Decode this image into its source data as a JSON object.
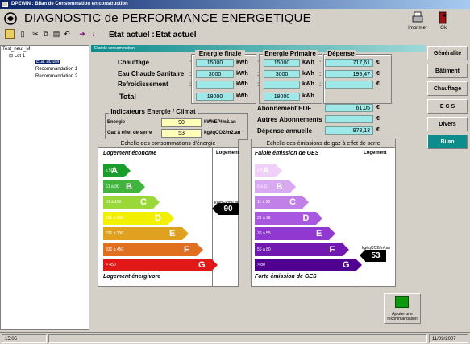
{
  "window_title": "DPEWIN : Bilan de Consommation en construction",
  "app_title": "DIAGNOSTIC de PERFORMANCE ENERGETIQUE",
  "etat_label": "Etat actuel :",
  "etat_value": "Etat actuel",
  "toolbar": {
    "print_label": "Imprimer",
    "ok_label": "Ok"
  },
  "tree": {
    "root": "Test_neuf_MI",
    "lot": "Lot 1",
    "items": [
      "Etat actuel",
      "Recommandation 1",
      "Recommandation 2"
    ]
  },
  "panel_title": "Etat de consommation",
  "columns": {
    "energie_finale": "Energie finale",
    "energie_primaire": "Energie Primaire",
    "depense": "Dépense"
  },
  "rows": [
    {
      "label": "Chauffage",
      "ef": "15000",
      "ef_unit": "kWh",
      "ep": "15000",
      "ep_unit": "kWh",
      "dep": "717,61",
      "dep_unit": "€"
    },
    {
      "label": "Eau Chaude Sanitaire",
      "ef": "3000",
      "ef_unit": "kWh",
      "ep": "3000",
      "ep_unit": "kWh",
      "dep": "199,47",
      "dep_unit": "€"
    },
    {
      "label": "Refroidissement",
      "ef": "",
      "ef_unit": "kWh",
      "ep": "",
      "ep_unit": "kWh",
      "dep": "",
      "dep_unit": "€"
    }
  ],
  "total": {
    "label": "Total",
    "ef": "18000",
    "ef_unit": "kWh",
    "ep": "18000",
    "ep_unit": "kWh"
  },
  "indicateurs": {
    "title": "Indicateurs Energie / Climat",
    "energie_label": "Energie",
    "energie_value": "90",
    "energie_unit": "kWhEP/m2.an",
    "ges_label": "Gaz à effet de serre",
    "ges_value": "53",
    "ges_unit": "kgéqCO2/m2.an"
  },
  "abonnements": [
    {
      "label": "Abonnement EDF",
      "value": "61,05",
      "unit": "€"
    },
    {
      "label": "Autres Abonnements",
      "value": "",
      "unit": "€"
    },
    {
      "label": "Dépense annuelle",
      "value": "978,13",
      "unit": "€"
    }
  ],
  "energy_label": {
    "title": "Echelle des consommations d'énergie",
    "top": "Logement économe",
    "bottom": "Logement énergivore",
    "col": "Logement",
    "value": "90",
    "unit": "kWhEP/m².an",
    "classes": [
      {
        "range": "≤ 50",
        "letter": "A",
        "color": "#1a9c2a"
      },
      {
        "range": "51 à 90",
        "letter": "B",
        "color": "#40b43c"
      },
      {
        "range": "91 à 150",
        "letter": "C",
        "color": "#9ad83a"
      },
      {
        "range": "151 à 230",
        "letter": "D",
        "color": "#f2f000"
      },
      {
        "range": "231 à 330",
        "letter": "E",
        "color": "#e0a020"
      },
      {
        "range": "331 à 450",
        "letter": "F",
        "color": "#e07020"
      },
      {
        "range": "> 450",
        "letter": "G",
        "color": "#e01818"
      }
    ]
  },
  "ges_label": {
    "title": "Echelle des émissions de gaz à effet de serre",
    "top": "Faible émission de GES",
    "bottom": "Forte émission de GES",
    "col": "Logement",
    "value": "53",
    "unit": "kgéqCO2/m².an",
    "classes": [
      {
        "range": "≤ 5",
        "letter": "A",
        "color": "#f0d0f8"
      },
      {
        "range": "6 à 10",
        "letter": "B",
        "color": "#d8a8f0"
      },
      {
        "range": "11 à 20",
        "letter": "C",
        "color": "#c080e8"
      },
      {
        "range": "21 à 35",
        "letter": "D",
        "color": "#a858e0"
      },
      {
        "range": "36 à 55",
        "letter": "E",
        "color": "#9038d0"
      },
      {
        "range": "56 à 80",
        "letter": "F",
        "color": "#7018b0"
      },
      {
        "range": "> 80",
        "letter": "G",
        "color": "#500090"
      }
    ]
  },
  "side_tabs": [
    "Généralité",
    "Bâtiment",
    "Chauffage",
    "E C S",
    "Divers",
    "Bilan"
  ],
  "active_tab": "Bilan",
  "add_reco_label": "Ajouter une recommandation",
  "status": {
    "left": "15:05",
    "right": "11/09/2007"
  }
}
